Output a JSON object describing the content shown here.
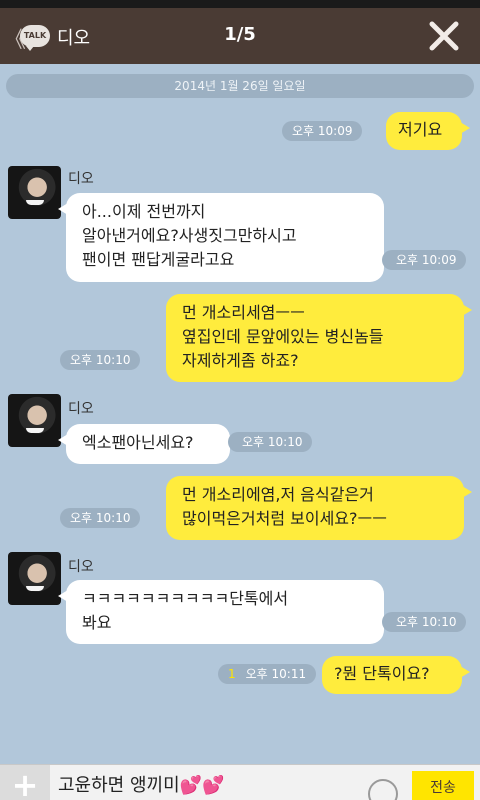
{
  "header": {
    "back_glyph": "《",
    "talk_badge": "TALK",
    "name": "디오",
    "page": "1/5"
  },
  "date_divider": "2014년 1월 26일 일요일",
  "messages": {
    "m1": {
      "text": "저기요",
      "time": "오후 10:09"
    },
    "m2": {
      "sender": "디오",
      "lines": [
        "아...이제 전번까지",
        "알아낸거에요?사생짓그만하시고",
        "팬이면 팬답게굴라고요"
      ],
      "time": "오후 10:09"
    },
    "m3": {
      "lines": [
        "먼 개소리세염ㅡㅡ",
        "옆집인데 문앞에있는 병신놈들",
        "자제하게좀 하죠?"
      ],
      "time": "오후 10:10"
    },
    "m4": {
      "sender": "디오",
      "text": "엑소팬아닌세요?",
      "time": "오후 10:10"
    },
    "m5": {
      "lines": [
        "먼 개소리에염,저 음식같은거",
        "많이먹은거처럼 보이세요?ㅡㅡ"
      ],
      "time": "오후 10:10"
    },
    "m6": {
      "sender": "디오",
      "lines": [
        "ㅋㅋㅋㅋㅋㅋㅋㅋㅋㅋ단톡에서",
        "봐요"
      ],
      "time": "오후 10:10"
    },
    "m7": {
      "text": "?뭔 단톡이요?",
      "time": "오후 10:11",
      "unread": "1"
    }
  },
  "input": {
    "plus": "+",
    "value": "고윤하면 앵끼미💕💕",
    "send": "전송"
  }
}
